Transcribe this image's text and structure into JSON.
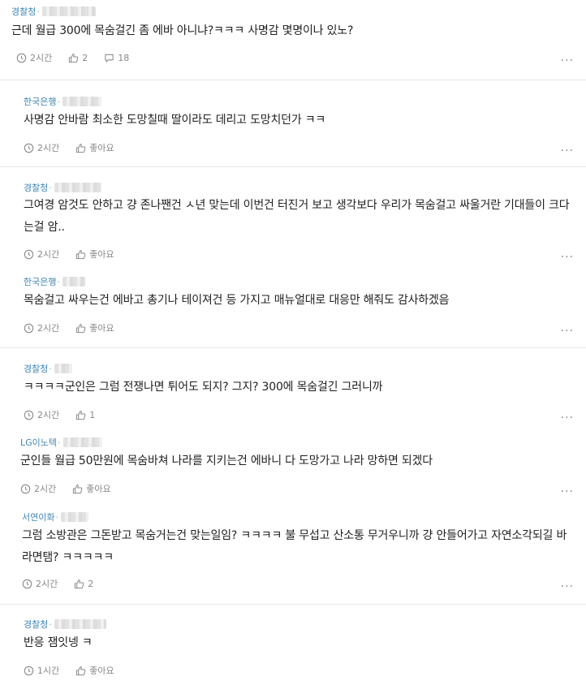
{
  "comments": [
    {
      "author": "경찰청",
      "body": "근데 월급 300에 목숨걸긴 좀 에바 아니냐?ㅋㅋㅋ 사명감 몇명이나 있노?",
      "time": "2시간",
      "likes": "2",
      "replies": "18"
    },
    {
      "author": "한국은행",
      "body": "사명감 안바람 최소한 도망칠때 딸이라도 데리고 도망치던가 ㅋㅋ",
      "time": "2시간",
      "likes": "좋아요"
    },
    {
      "author": "경찰청",
      "body": "그여경 암것도 안하고 걍 존나짼건 ㅅ년 맞는데 이번건 터진거 보고 생각보다 우리가 목숨걸고 싸울거란 기대들이 크다는걸 암..",
      "time": "2시간",
      "likes": "좋아요"
    },
    {
      "author": "한국은행",
      "body": "목숨걸고 싸우는건 에바고 총기나 테이져건 등 가지고 매뉴얼대로 대응만 해줘도 감사하겠음",
      "time": "2시간",
      "likes": "좋아요"
    },
    {
      "author": "경찰청",
      "body": "ㅋㅋㅋㅋ군인은 그럼 전쟁나면 튀어도 되지? 그지? 300에 목숨걸긴 그러니까",
      "time": "2시간",
      "likes": "1"
    },
    {
      "author": "LG이노텍",
      "body": "군인들 월급 50만원에 목숨바쳐 나라를 지키는건 에바니 다 도망가고 나라 망하면 되겠다",
      "time": "2시간",
      "likes": "좋아요"
    },
    {
      "author": "서연이화",
      "body": "그럼 소방관은 그돈받고 목숨거는건 맞는일임? ㅋㅋㅋㅋ 불 무섭고 산소통 무거우니까 걍 안들어가고 자연소각되길 바라면탬? ㅋㅋㅋㅋㅋ",
      "time": "2시간",
      "likes": "2"
    },
    {
      "author": "경찰청",
      "body": "반응 잼잇넹 ㅋ",
      "time": "1시간",
      "likes": "좋아요"
    }
  ],
  "icons": {
    "time": "clock-icon",
    "like": "thumbs-up-icon",
    "reply": "speech-bubble-icon",
    "more": "more-dots-icon"
  }
}
